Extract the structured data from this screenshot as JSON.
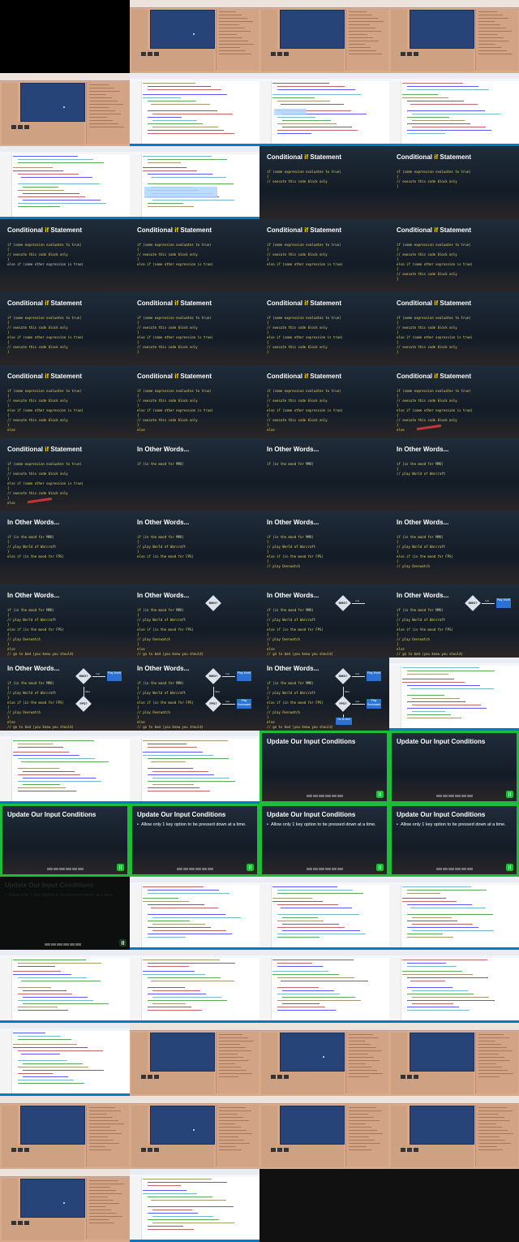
{
  "colors": {
    "unity_bg": "#d9ab8c",
    "unity_game_view": "#264478",
    "vs_editor_bg": "#ffffff",
    "vs_status_bar": "#007acc",
    "slide_keyword": "#f5d327",
    "slide_code": "#e6d46a",
    "green_frame": "#1fbc3c",
    "diagram_box": "#2b72d4"
  },
  "slides": {
    "conditional_title": "Conditional",
    "conditional_keyword": "if",
    "conditional_suffix": "Statement",
    "other_words_title": "In Other Words...",
    "update_title": "Update Our Input Conditions",
    "update_bullet": "Allow only 1 key option to be pressed down at a time."
  },
  "code": {
    "if_cond": "if (some expression evaluates to true)",
    "open_brace": "{",
    "close_brace": "}",
    "exec_comment": "// execute this code block only",
    "elseif_cond": "else if (some other expression is true)",
    "else_kw": "else",
    "mood_mmo": "if (in the mood for MMO)",
    "play_wow": "// play World of Warcraft",
    "play_wow_partial": "// play World of Warcraft",
    "mood_fps": "else if (in the mood for FPS)",
    "play_ow": "// play Overwatch",
    "go_bed": "// go to bed (you know you should)"
  },
  "diagram": {
    "mmo_q": "MMO?",
    "fps_q": "FPS?",
    "true_label": "true",
    "false_label": "false",
    "play_wow": "Play WoW",
    "play_ow": "Play Overwatch",
    "go_bed": "Go to bed"
  },
  "tiles": [
    "black",
    "unity",
    "unity",
    "unity",
    "unity",
    "vs",
    "vs",
    "vs",
    "vs",
    "vs",
    "s1",
    "s2",
    "s3",
    "s4",
    "s4",
    "s5",
    "s5",
    "s5",
    "s6",
    "s6",
    "s7",
    "s7",
    "s7",
    "s8",
    "s8",
    "o1",
    "o1",
    "o2",
    "o3",
    "o3",
    "o4",
    "o4",
    "o5",
    "o6",
    "o7",
    "o8",
    "o9",
    "o10",
    "o11",
    "vs",
    "vs",
    "vs",
    "g0",
    "g0",
    "g0",
    "g1",
    "g1",
    "g1",
    "gd",
    "vs",
    "vs",
    "vs",
    "vs",
    "vs",
    "vs",
    "vs",
    "vs",
    "unity",
    "unity",
    "unity",
    "unity",
    "unity",
    "unity",
    "unity",
    "unity",
    "vs",
    "empty",
    "empty"
  ]
}
